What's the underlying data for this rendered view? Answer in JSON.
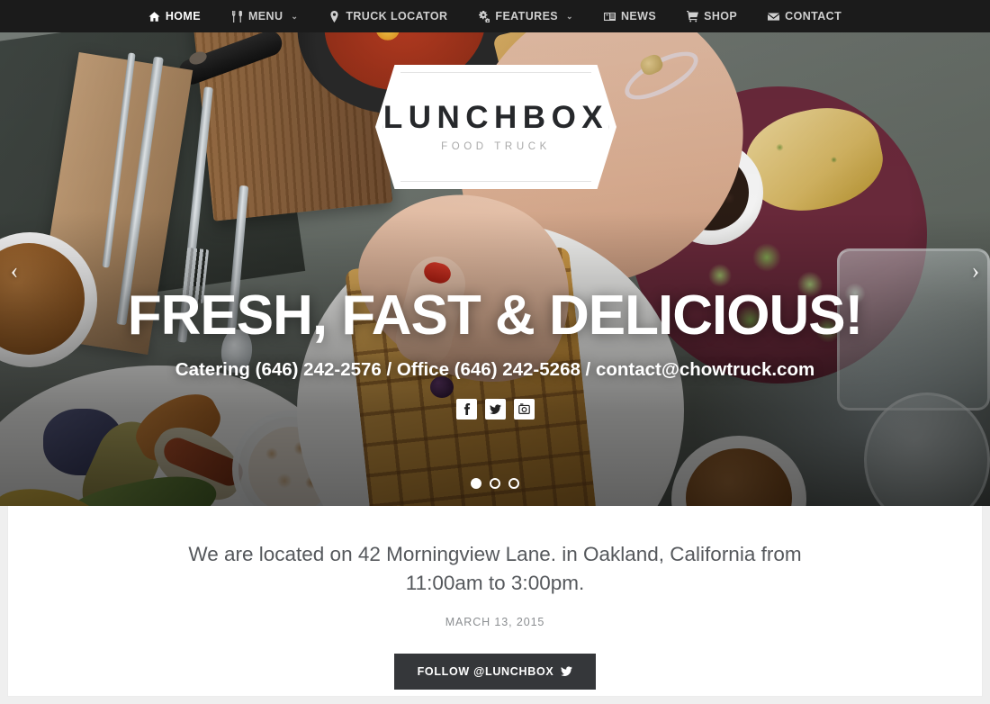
{
  "nav": {
    "items": [
      {
        "label": "HOME",
        "icon": "home-icon",
        "active": true,
        "caret": false
      },
      {
        "label": "MENU",
        "icon": "cutlery-icon",
        "active": false,
        "caret": true
      },
      {
        "label": "TRUCK LOCATOR",
        "icon": "map-marker-icon",
        "active": false,
        "caret": false
      },
      {
        "label": "FEATURES",
        "icon": "cogs-icon",
        "active": false,
        "caret": true
      },
      {
        "label": "NEWS",
        "icon": "newspaper-icon",
        "active": false,
        "caret": false
      },
      {
        "label": "SHOP",
        "icon": "shopping-cart-icon",
        "active": false,
        "caret": false
      },
      {
        "label": "CONTACT",
        "icon": "envelope-icon",
        "active": false,
        "caret": false
      }
    ],
    "caret_glyph": "⌄",
    "background": "#1b1b1b",
    "active_color": "#ffffff",
    "inactive_color": "#cfcfcf"
  },
  "logo": {
    "name": "LUNCHBOX",
    "tagline": "FOOD TRUCK",
    "name_color": "#26282b",
    "tagline_color": "#a9a9a9",
    "badge_color": "#ffffff"
  },
  "hero": {
    "headline": "FRESH, FAST & DELICIOUS!",
    "subheadline": "Catering (646) 242-2576 / Office (646) 242-5268 / contact@chowtruck.com",
    "social": [
      {
        "name": "facebook-icon",
        "label": "Facebook"
      },
      {
        "name": "twitter-icon",
        "label": "Twitter"
      },
      {
        "name": "instagram-icon",
        "label": "Instagram"
      }
    ],
    "prev_arrow": "‹",
    "next_arrow": "›",
    "slides": [
      {
        "active": true
      },
      {
        "active": false
      },
      {
        "active": false
      }
    ]
  },
  "post": {
    "title": "We are located on 42 Morningview Lane. in Oakland, California from 11:00am to 3:00pm.",
    "date": "MARCH 13, 2015",
    "follow_label": "FOLLOW @LUNCHBOX",
    "follow_icon": "twitter-icon",
    "follow_bg": "#35373a",
    "title_color": "#55585c",
    "date_color": "#8b8e91"
  }
}
